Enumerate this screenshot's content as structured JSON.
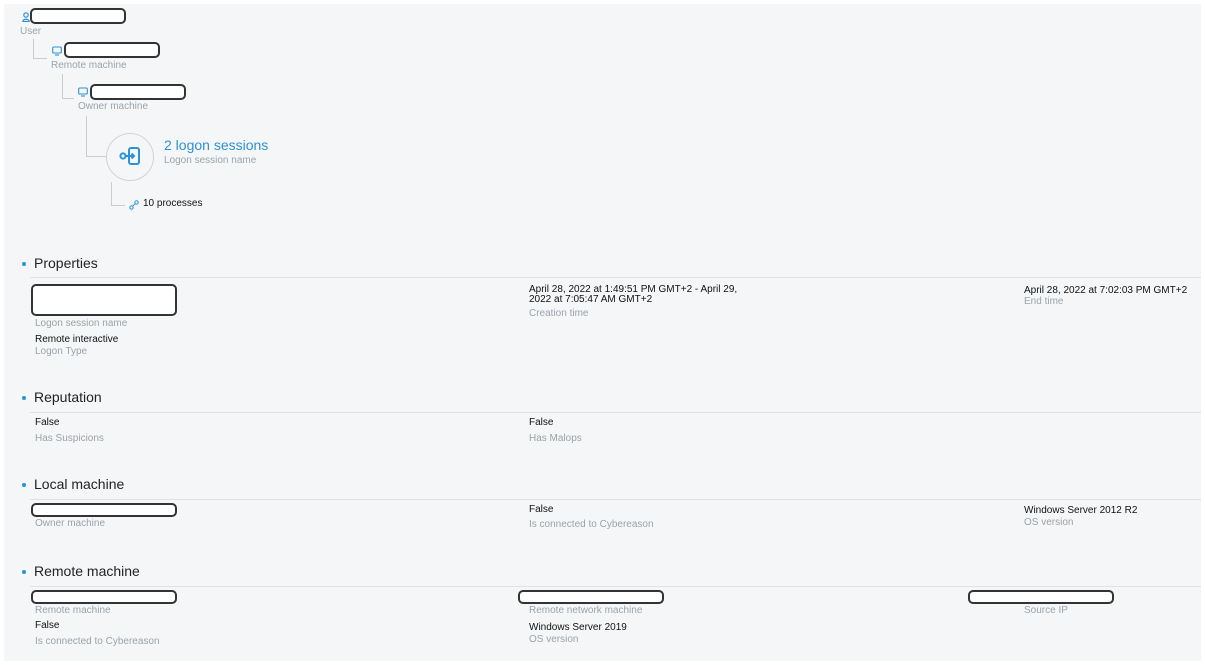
{
  "tree": {
    "user_label": "User",
    "remote_machine_label": "Remote machine",
    "owner_machine_label": "Owner machine",
    "sessions_title": "2 logon sessions",
    "sessions_subtitle": "Logon session name",
    "processes": "10 processes",
    "icons": [
      "user-icon",
      "monitor-icon",
      "logon-session-icon",
      "processes-icon"
    ]
  },
  "accent_color": "#2c92d6",
  "sections": {
    "properties": {
      "title": "Properties",
      "logon_session_name_label": "Logon session name",
      "logon_type_value": "Remote interactive",
      "logon_type_label": "Logon Type",
      "creation_time_value": "April 28, 2022 at 1:49:51 PM GMT+2 - April 29, 2022 at 7:05:47 AM GMT+2",
      "creation_time_label": "Creation time",
      "end_time_value": "April 28, 2022 at 7:02:03 PM GMT+2",
      "end_time_label": "End time"
    },
    "reputation": {
      "title": "Reputation",
      "has_suspicions_value": "False",
      "has_suspicions_label": "Has Suspicions",
      "has_malops_value": "False",
      "has_malops_label": "Has Malops"
    },
    "local_machine": {
      "title": "Local machine",
      "owner_machine_label": "Owner machine",
      "connected_value": "False",
      "connected_label": "Is connected to Cybereason",
      "os_value": "Windows Server 2012 R2",
      "os_label": "OS version"
    },
    "remote_machine": {
      "title": "Remote machine",
      "remote_machine_label": "Remote machine",
      "connected_value": "False",
      "connected_label": "Is connected to Cybereason",
      "remote_network_label": "Remote network machine",
      "os_value": "Windows Server 2019",
      "os_label": "OS version",
      "source_ip_label": "Source IP"
    }
  }
}
